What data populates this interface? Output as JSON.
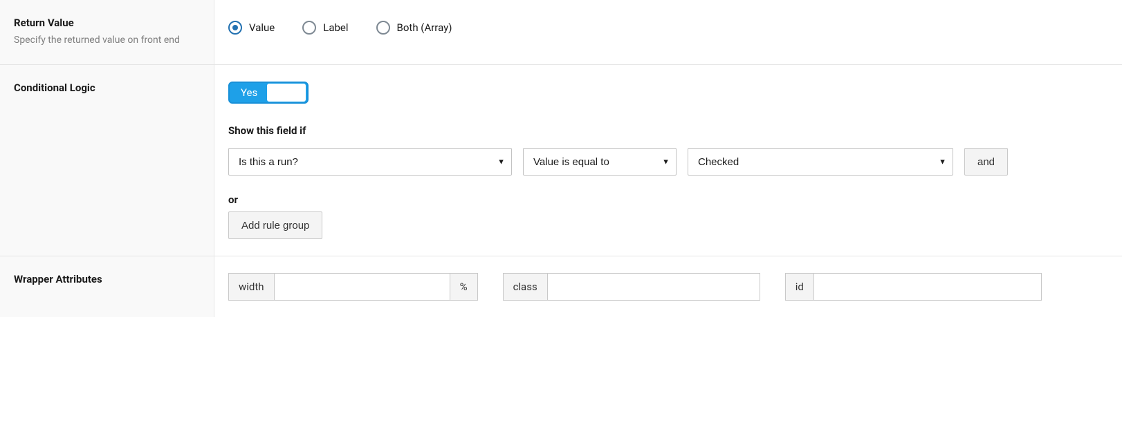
{
  "return_value": {
    "title": "Return Value",
    "description": "Specify the returned value on front end",
    "options": [
      {
        "label": "Value",
        "checked": true
      },
      {
        "label": "Label",
        "checked": false
      },
      {
        "label": "Both (Array)",
        "checked": false
      }
    ]
  },
  "conditional_logic": {
    "title": "Conditional Logic",
    "toggle_label": "Yes",
    "heading": "Show this field if",
    "rule": {
      "field": "Is this a run?",
      "operator": "Value is equal to",
      "value": "Checked"
    },
    "and_label": "and",
    "or_label": "or",
    "add_rule_label": "Add rule group"
  },
  "wrapper": {
    "title": "Wrapper Attributes",
    "width_label": "width",
    "width_suffix": "%",
    "width_value": "",
    "class_label": "class",
    "class_value": "",
    "id_label": "id",
    "id_value": ""
  }
}
